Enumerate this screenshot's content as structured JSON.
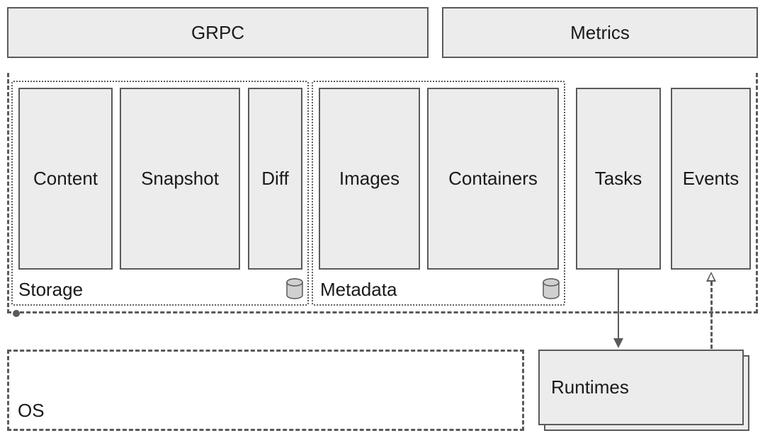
{
  "top_row": {
    "grpc": "GRPC",
    "metrics": "Metrics"
  },
  "storage": {
    "label": "Storage",
    "content": "Content",
    "snapshot": "Snapshot",
    "diff": "Diff"
  },
  "metadata": {
    "label": "Metadata",
    "images": "Images",
    "containers": "Containers"
  },
  "tasks": "Tasks",
  "events": "Events",
  "runtimes": "Runtimes",
  "os": "OS"
}
